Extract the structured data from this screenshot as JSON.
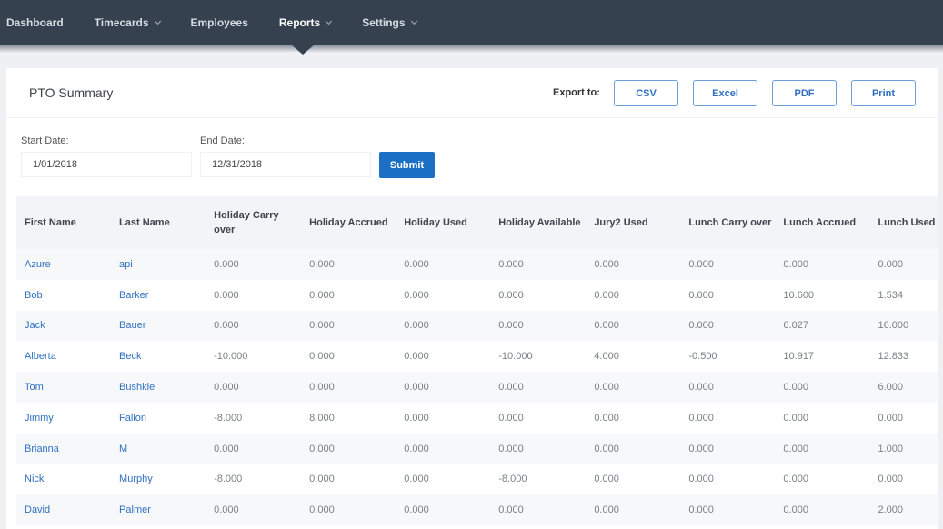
{
  "nav": {
    "items": [
      {
        "label": "Dashboard",
        "has_dropdown": false,
        "active": false
      },
      {
        "label": "Timecards",
        "has_dropdown": true,
        "active": false
      },
      {
        "label": "Employees",
        "has_dropdown": false,
        "active": false
      },
      {
        "label": "Reports",
        "has_dropdown": true,
        "active": true
      },
      {
        "label": "Settings",
        "has_dropdown": true,
        "active": false
      }
    ]
  },
  "page": {
    "title": "PTO Summary",
    "export_label": "Export to:",
    "export_buttons": [
      "CSV",
      "Excel",
      "PDF",
      "Print"
    ]
  },
  "filters": {
    "start_label": "Start Date:",
    "start_value": "1/01/2018",
    "end_label": "End Date:",
    "end_value": "12/31/2018",
    "submit_label": "Submit"
  },
  "table": {
    "columns": [
      "First Name",
      "Last Name",
      "Holiday Carry over",
      "Holiday Accrued",
      "Holiday Used",
      "Holiday Available",
      "Jury2 Used",
      "Lunch Carry over",
      "Lunch Accrued",
      "Lunch Used"
    ],
    "rows": [
      [
        "Azure",
        "api",
        "0.000",
        "0.000",
        "0.000",
        "0.000",
        "0.000",
        "0.000",
        "0.000",
        "0.000"
      ],
      [
        "Bob",
        "Barker",
        "0.000",
        "0.000",
        "0.000",
        "0.000",
        "0.000",
        "0.000",
        "10.600",
        "1.534"
      ],
      [
        "Jack",
        "Bauer",
        "0.000",
        "0.000",
        "0.000",
        "0.000",
        "0.000",
        "0.000",
        "6.027",
        "16.000"
      ],
      [
        "Alberta",
        "Beck",
        "-10.000",
        "0.000",
        "0.000",
        "-10.000",
        "4.000",
        "-0.500",
        "10.917",
        "12.833"
      ],
      [
        "Tom",
        "Bushkie",
        "0.000",
        "0.000",
        "0.000",
        "0.000",
        "0.000",
        "0.000",
        "0.000",
        "6.000"
      ],
      [
        "Jimmy",
        "Fallon",
        "-8.000",
        "8.000",
        "0.000",
        "0.000",
        "0.000",
        "0.000",
        "0.000",
        "0.000"
      ],
      [
        "Brianna",
        "M",
        "0.000",
        "0.000",
        "0.000",
        "0.000",
        "0.000",
        "0.000",
        "0.000",
        "1.000"
      ],
      [
        "Nick",
        "Murphy",
        "-8.000",
        "0.000",
        "0.000",
        "-8.000",
        "0.000",
        "0.000",
        "0.000",
        "0.000"
      ],
      [
        "David",
        "Palmer",
        "0.000",
        "0.000",
        "0.000",
        "0.000",
        "0.000",
        "0.000",
        "0.000",
        "2.000"
      ]
    ]
  },
  "colors": {
    "nav_bg": "#36414f",
    "accent": "#1b6fc4",
    "link": "#2f70c2"
  }
}
